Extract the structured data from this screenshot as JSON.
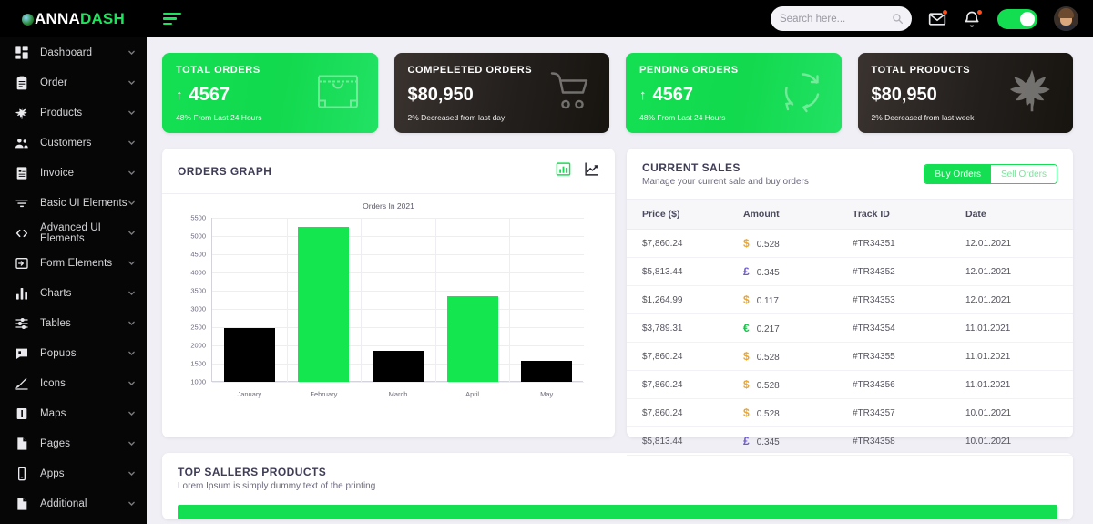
{
  "brand": {
    "name_part1": "ANNA",
    "name_part2": "DASH",
    "mark": "cannabis-logo-icon"
  },
  "topnav": {
    "menu_toggle": "hamburger-icon",
    "search": {
      "placeholder": "Search here...",
      "value": ""
    },
    "mail_icon": "envelope-icon",
    "bell_icon": "bell-icon",
    "theme_toggle": "toggle-switch-on",
    "avatar": "user-avatar"
  },
  "sidebar": {
    "items": [
      {
        "label": "Dashboard",
        "icon": "grid-icon"
      },
      {
        "label": "Order",
        "icon": "clipboard-icon"
      },
      {
        "label": "Products",
        "icon": "leaf-icon"
      },
      {
        "label": "Customers",
        "icon": "users-icon"
      },
      {
        "label": "Invoice",
        "icon": "document-list-icon"
      },
      {
        "label": "Basic UI Elements",
        "icon": "filter-icon"
      },
      {
        "label": "Advanced UI Elements",
        "icon": "code-icon"
      },
      {
        "label": "Form Elements",
        "icon": "form-input-icon"
      },
      {
        "label": "Charts",
        "icon": "bar-chart-icon"
      },
      {
        "label": "Tables",
        "icon": "table-icon"
      },
      {
        "label": "Popups",
        "icon": "chat-bubble-icon"
      },
      {
        "label": "Icons",
        "icon": "pen-icon"
      },
      {
        "label": "Maps",
        "icon": "map-icon"
      },
      {
        "label": "Pages",
        "icon": "page-icon"
      },
      {
        "label": "Apps",
        "icon": "mobile-icon"
      },
      {
        "label": "Additional",
        "icon": "file-icon"
      }
    ]
  },
  "stats": [
    {
      "title": "TOTAL ORDERS",
      "value": "4567",
      "trend": "up",
      "sub": "48% From Last 24 Hours",
      "style": "green",
      "icon": "shopping-bag-icon"
    },
    {
      "title": "COMPELETED ORDERS",
      "value": "$80,950",
      "trend": "none",
      "sub": "2% Decreased from last day",
      "style": "dark",
      "icon": "shopping-cart-icon"
    },
    {
      "title": "PENDING ORDERS",
      "value": "4567",
      "trend": "up",
      "sub": "48% From Last 24 Hours",
      "style": "green",
      "icon": "refresh-cycle-icon"
    },
    {
      "title": "TOTAL PRODUCTS",
      "value": "$80,950",
      "trend": "none",
      "sub": "2% Decreased from last week",
      "style": "dark",
      "icon": "cannabis-leaf-icon"
    }
  ],
  "graph_panel": {
    "title": "ORDERS GRAPH",
    "icon_bar": "bar-chart-icon",
    "icon_line": "line-chart-icon"
  },
  "chart_data": {
    "type": "bar",
    "title": "Orders In 2021",
    "categories": [
      "January",
      "February",
      "March",
      "April",
      "May"
    ],
    "values": [
      2480,
      5250,
      1850,
      3360,
      1570
    ],
    "colors": [
      "#000000",
      "#14e64f",
      "#000000",
      "#14e64f",
      "#000000"
    ],
    "xlabel": "",
    "ylabel": "",
    "ylim": [
      1000,
      5500
    ],
    "yticks": [
      1000,
      1500,
      2000,
      2500,
      3000,
      3500,
      4000,
      4500,
      5000,
      5500
    ],
    "grid": true,
    "legend": false
  },
  "sales_panel": {
    "title": "CURRENT SALES",
    "subtitle": "Manage your current sale and buy orders",
    "tab_buy": "Buy Orders",
    "tab_sell": "Sell Orders",
    "columns": [
      "Price ($)",
      "Amount",
      "Track ID",
      "Date"
    ],
    "rows": [
      {
        "price": "$7,860.24",
        "cur": "$",
        "cur_class": "usd",
        "amount": "0.528",
        "track": "#TR34351",
        "date": "12.01.2021"
      },
      {
        "price": "$5,813.44",
        "cur": "£",
        "cur_class": "gbp",
        "amount": "0.345",
        "track": "#TR34352",
        "date": "12.01.2021"
      },
      {
        "price": "$1,264.99",
        "cur": "$",
        "cur_class": "usd",
        "amount": "0.117",
        "track": "#TR34353",
        "date": "12.01.2021"
      },
      {
        "price": "$3,789.31",
        "cur": "€",
        "cur_class": "eur",
        "amount": "0.217",
        "track": "#TR34354",
        "date": "11.01.2021"
      },
      {
        "price": "$7,860.24",
        "cur": "$",
        "cur_class": "usd",
        "amount": "0.528",
        "track": "#TR34355",
        "date": "11.01.2021"
      },
      {
        "price": "$7,860.24",
        "cur": "$",
        "cur_class": "usd",
        "amount": "0.528",
        "track": "#TR34356",
        "date": "11.01.2021"
      },
      {
        "price": "$7,860.24",
        "cur": "$",
        "cur_class": "usd",
        "amount": "0.528",
        "track": "#TR34357",
        "date": "10.01.2021"
      },
      {
        "price": "$5,813.44",
        "cur": "£",
        "cur_class": "gbp",
        "amount": "0.345",
        "track": "#TR34358",
        "date": "10.01.2021"
      }
    ]
  },
  "bottom_panel": {
    "title": "TOP SALLERS PRODUCTS",
    "subtitle": "Lorem Ipsum is simply dummy text of the printing"
  },
  "colors": {
    "accent": "#14df52",
    "dark": "#000000",
    "page_bg": "#f0eff5"
  }
}
